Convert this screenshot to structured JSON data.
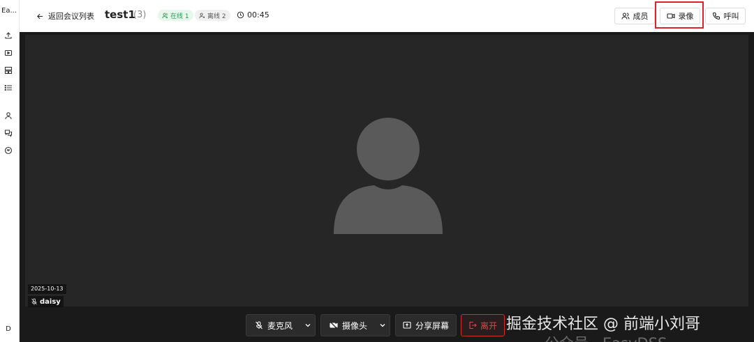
{
  "sidebar": {
    "logo_text": "Ea...",
    "items": [
      {
        "icon": "upload-icon"
      },
      {
        "icon": "video-play-icon"
      },
      {
        "icon": "layout-icon"
      },
      {
        "icon": "list-icon"
      },
      {
        "icon": "user-icon"
      },
      {
        "icon": "chat-icon"
      },
      {
        "icon": "refresh-circle-icon"
      }
    ],
    "user_initial": "D"
  },
  "header": {
    "back_label": "返回会议列表",
    "room_title": "test1",
    "room_count": "(3)",
    "online_badge": "在线 1",
    "offline_badge": "离线 2",
    "timer": "00:45",
    "members_label": "成员",
    "record_label": "录像",
    "call_label": "呼叫"
  },
  "video": {
    "date": "2025-10-13",
    "participant_name": "daisy"
  },
  "controls": {
    "mic_label": "麦克风",
    "camera_label": "摄像头",
    "share_label": "分享屏幕",
    "leave_label": "离开"
  },
  "watermark": {
    "overlay_text": "公众号 · EasyDSS",
    "main_text": "掘金技术社区 @ 前端小刘哥"
  },
  "colors": {
    "accent_red": "#e0202a",
    "online_green": "#1f9d55",
    "stage_bg": "#1a1a1a"
  }
}
